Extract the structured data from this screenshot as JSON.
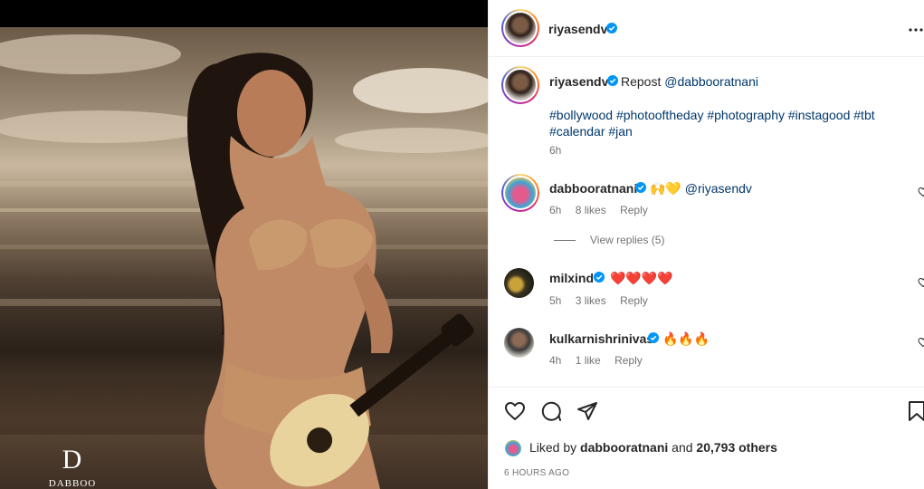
{
  "post": {
    "author": "riyasendv",
    "more_icon": "more-horizontal-icon"
  },
  "caption": {
    "author": "riyasendv",
    "repost_prefix": "Repost",
    "repost_mention": "@dabbooratnani",
    "hashtags": "#bollywood #photooftheday #photography #instagood #tbt #calendar #jan",
    "time": "6h"
  },
  "comments": [
    {
      "user": "dabbooratnani",
      "emoji": "🙌💛",
      "mention": "@riyasendv",
      "time": "6h",
      "likes": "8 likes",
      "reply": "Reply"
    },
    {
      "user": "milxind",
      "emoji": "❤️❤️❤️❤️",
      "time": "5h",
      "likes": "3 likes",
      "reply": "Reply"
    },
    {
      "user": "kulkarnishrinivas",
      "emoji": "🔥🔥🔥",
      "time": "4h",
      "likes": "1 like",
      "reply": "Reply"
    }
  ],
  "view_replies": "View replies (5)",
  "actions": {
    "like_icon": "heart-icon",
    "comment_icon": "comment-icon",
    "share_icon": "send-icon",
    "save_icon": "bookmark-icon"
  },
  "likes": {
    "prefix": "Liked by",
    "user": "dabbooratnani",
    "middle": "and",
    "count": "20,793 others"
  },
  "timestamp": "6 HOURS AGO",
  "watermark": {
    "monogram": "D",
    "name": "DABBOO RATNANI"
  },
  "colors": {
    "verified": "#0095f6",
    "link": "#00376b",
    "muted": "#737373"
  }
}
